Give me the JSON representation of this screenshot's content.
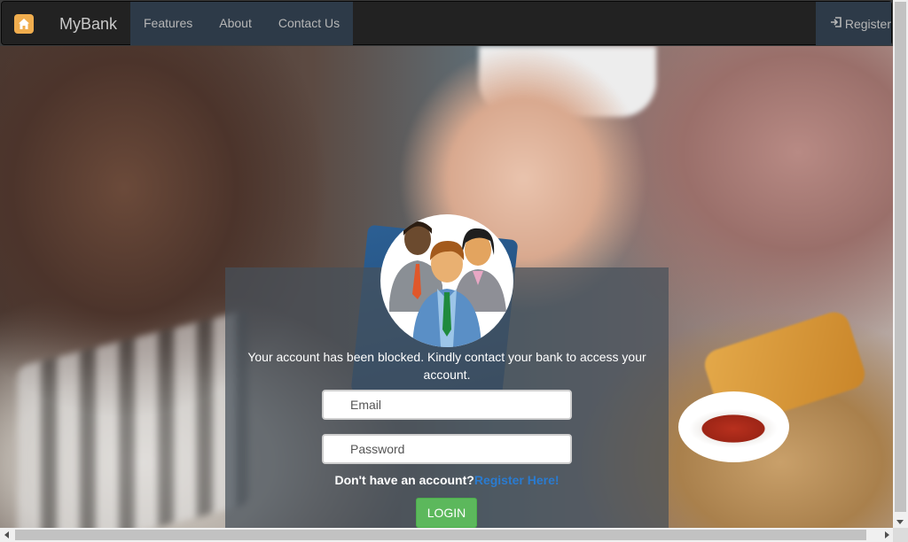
{
  "navbar": {
    "home_icon": "home-icon",
    "brand": "MyBank",
    "links": [
      "Features",
      "About",
      "Contact Us"
    ],
    "register_icon": "sign-in-icon",
    "register_label": "Register"
  },
  "login": {
    "avatar_icon": "user-group-icon",
    "message": "Your account has been blocked. Kindly contact your bank to access your account.",
    "email_placeholder": "Email",
    "password_placeholder": "Password",
    "signup_prompt": "Don't have an account?",
    "signup_link": "Register Here!",
    "login_button": "LOGIN"
  },
  "colors": {
    "navbar_bg": "#222222",
    "accent_green": "#5cb85c",
    "link_blue": "#2a7bd0",
    "home_orange": "#f0ad4e"
  }
}
